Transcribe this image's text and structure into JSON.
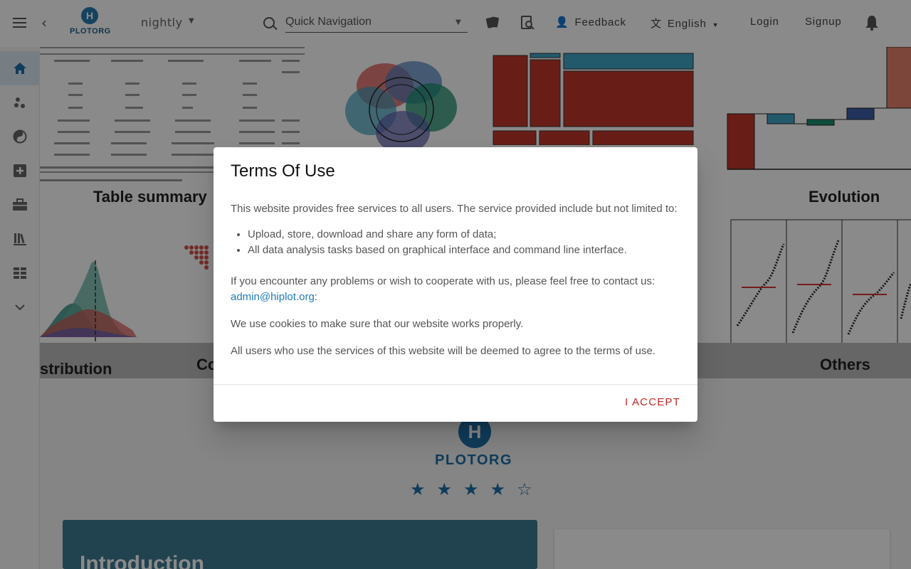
{
  "header": {
    "logo_letter": "H",
    "logo_text": "PLOTORG",
    "version": "nightly",
    "search_placeholder": "Quick Navigation",
    "feedback_label": "Feedback",
    "language_label": "English",
    "login_label": "Login",
    "signup_label": "Signup",
    "icons": [
      "menu-icon",
      "back-icon",
      "search-icon",
      "cards-icon",
      "doc-search-icon",
      "feedback-icon",
      "translate-icon",
      "bell-icon"
    ]
  },
  "sidebar": {
    "items": [
      {
        "name": "home",
        "icon": "home-icon",
        "active": true
      },
      {
        "name": "scatter",
        "icon": "scatter-icon",
        "active": false
      },
      {
        "name": "yin-yang",
        "icon": "yin-yang-icon",
        "active": false
      },
      {
        "name": "add",
        "icon": "plus-box-icon",
        "active": false
      },
      {
        "name": "toolbox",
        "icon": "toolbox-icon",
        "active": false
      },
      {
        "name": "library",
        "icon": "library-icon",
        "active": false
      },
      {
        "name": "grid",
        "icon": "grid-icon",
        "active": false
      },
      {
        "name": "more",
        "icon": "chevron-down-icon",
        "active": false
      }
    ]
  },
  "hero": {
    "captions": [
      "Table summary",
      "Evolution",
      "stribution",
      "Co",
      "Others"
    ]
  },
  "brand": {
    "logo_letter": "H",
    "logo_text": "PLOTORG",
    "rating": 4,
    "rating_max": 5
  },
  "intro": {
    "title": "Introduction"
  },
  "dialog": {
    "title": "Terms Of Use",
    "intro": "This website provides free services to all users. The service provided include but not limited to:",
    "items": [
      "Upload, store, download and share any form of data;",
      "All data analysis tasks based on graphical interface and command line interface."
    ],
    "contact_text": "If you encounter any problems or wish to cooperate with us, please feel free to contact us:",
    "contact_email": "admin@hiplot.org",
    "contact_suffix": ":",
    "cookies": "We use cookies to make sure that our website works properly.",
    "agree": "All users who use the services of this website will be deemed to agree to the terms of use.",
    "accept_label": "I ACCEPT"
  },
  "colors": {
    "accent": "#1f6fa8",
    "accept": "#c62828",
    "intro_card": "#3d7a93"
  }
}
